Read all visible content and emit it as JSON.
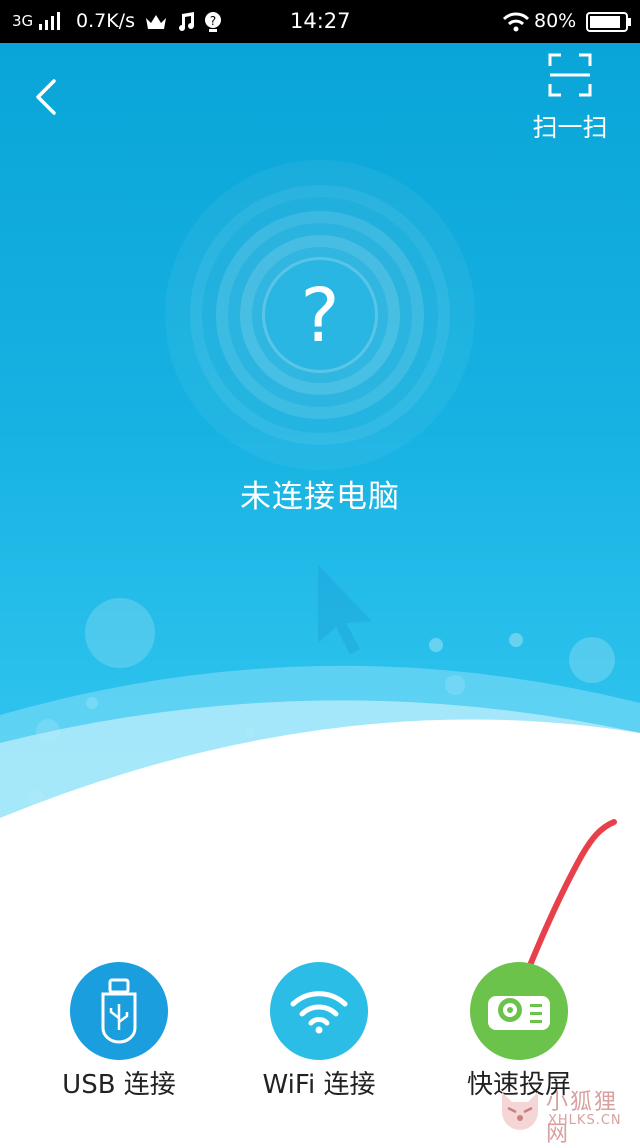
{
  "status_bar": {
    "network": "3G",
    "speed": "0.7K/s",
    "time": "14:27",
    "battery": "80%"
  },
  "header": {
    "back_icon": "chevron-left-icon",
    "scan_icon": "scan-frame-icon",
    "scan_label": "扫一扫"
  },
  "connection": {
    "status_text": "未连接电脑",
    "icon": "question-mark-icon"
  },
  "actions": [
    {
      "label": "USB 连接",
      "icon": "usb-drive-icon",
      "color": "#1a9ede"
    },
    {
      "label": "WiFi 连接",
      "icon": "wifi-icon",
      "color": "#2bbde6"
    },
    {
      "label": "快速投屏",
      "icon": "projector-icon",
      "color": "#6cc34c"
    }
  ],
  "annotation_color": "#e8404a",
  "watermark": {
    "text_cn": "小狐狸网",
    "text_en": "XHLKS.CN"
  }
}
